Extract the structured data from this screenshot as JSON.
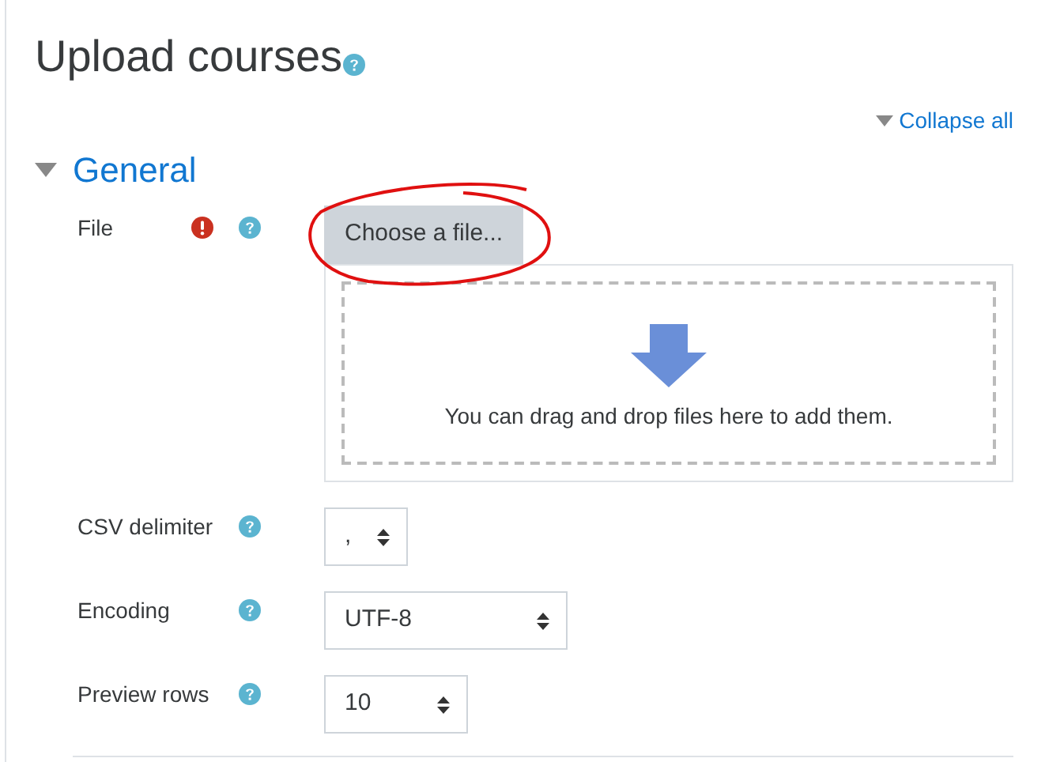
{
  "page_title": "Upload courses",
  "collapse_all": "Collapse all",
  "section": {
    "title": "General",
    "expanded": true
  },
  "fields": [
    {
      "kind": "file",
      "label": "File",
      "required": true,
      "button": "Choose a file...",
      "dropzone_text": "You can drag and drop files here to add them."
    },
    {
      "kind": "select",
      "label": "CSV delimiter",
      "required": false,
      "value": ","
    },
    {
      "kind": "select",
      "label": "Encoding",
      "required": false,
      "value": "UTF-8"
    },
    {
      "kind": "select",
      "label": "Preview rows",
      "required": false,
      "value": "10"
    }
  ]
}
